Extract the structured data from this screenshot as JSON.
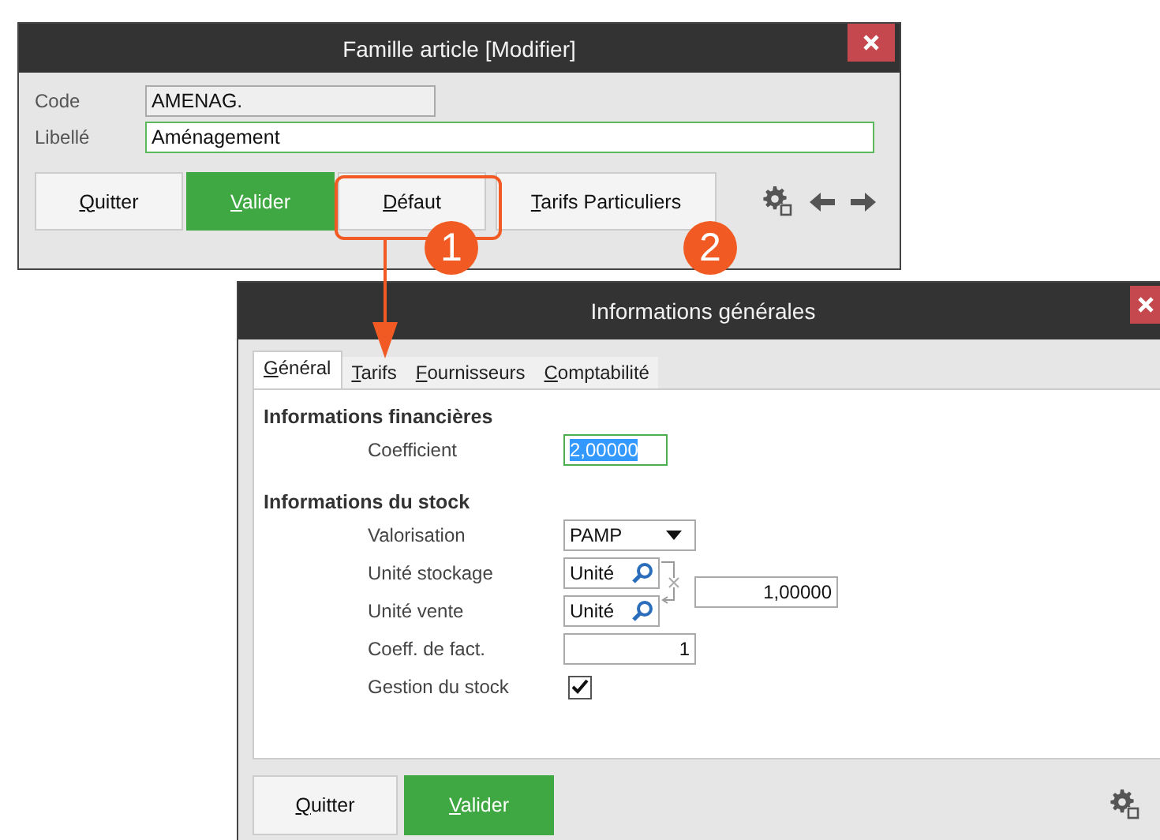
{
  "main_window": {
    "title": "Famille article [Modifier]",
    "fields": [
      {
        "label": "Code",
        "value": "AMENAG.",
        "disabled": true
      },
      {
        "label": "Libellé",
        "value": "Aménagement",
        "disabled": false
      }
    ],
    "buttons": [
      {
        "label": "Quitter",
        "kind": "plain"
      },
      {
        "label": "Valider",
        "kind": "primary"
      },
      {
        "label": "Défaut",
        "kind": "plain"
      },
      {
        "label": "Tarifs Particuliers",
        "kind": "plain"
      }
    ]
  },
  "annotations": [
    {
      "label": "1"
    },
    {
      "label": "2"
    }
  ],
  "dialog": {
    "title": "Informations générales",
    "tabs": [
      {
        "label": "Général",
        "selected": true
      },
      {
        "label": "Tarifs",
        "selected": false
      },
      {
        "label": "Fournisseurs",
        "selected": false
      },
      {
        "label": "Comptabilité",
        "selected": false
      }
    ],
    "sections": [
      {
        "title": "Informations financières",
        "rows": [
          {
            "kind": "input",
            "label": "Coefficient",
            "value": "2,00000",
            "selected": true
          }
        ]
      },
      {
        "title": "Informations du stock",
        "rows": [
          {
            "kind": "select",
            "label": "Valorisation",
            "value": "PAMP"
          },
          {
            "kind": "lookup",
            "label": "Unité stockage",
            "value": "Unité"
          },
          {
            "kind": "lookup",
            "label": "Unité vente",
            "value": "Unité"
          },
          {
            "kind": "number",
            "label": "Coeff. de fact.",
            "value": "1"
          },
          {
            "kind": "checkbox",
            "label": "Gestion du stock",
            "checked": true
          }
        ]
      }
    ],
    "conversion": {
      "value": "1,00000"
    },
    "buttons": [
      {
        "label": "Quitter",
        "kind": "plain"
      },
      {
        "label": "Valider",
        "kind": "primary"
      }
    ]
  }
}
